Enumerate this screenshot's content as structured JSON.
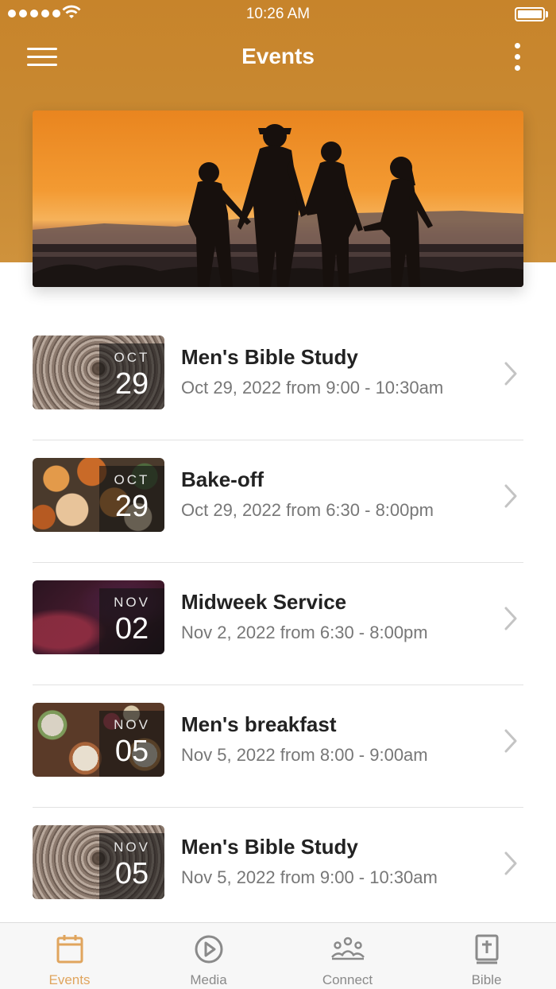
{
  "status_bar": {
    "time": "10:26 AM"
  },
  "nav": {
    "title": "Events",
    "menu_icon": "hamburger-menu-icon",
    "more_icon": "more-vertical-icon"
  },
  "hero": {
    "description_icon": "family-sunset-photo"
  },
  "events": [
    {
      "month": "OCT",
      "day": "29",
      "title": "Men's Bible Study",
      "when": "Oct 29, 2022 from 9:00 - 10:30am",
      "thumb": "wood"
    },
    {
      "month": "OCT",
      "day": "29",
      "title": "Bake-off",
      "when": "Oct 29, 2022 from 6:30 - 8:00pm",
      "thumb": "pumpkin"
    },
    {
      "month": "NOV",
      "day": "02",
      "title": "Midweek Service",
      "when": "Nov 2, 2022 from 6:30 - 8:00pm",
      "thumb": "purple"
    },
    {
      "month": "NOV",
      "day": "05",
      "title": "Men's breakfast",
      "when": "Nov 5, 2022 from 8:00 - 9:00am",
      "thumb": "breakfast"
    },
    {
      "month": "NOV",
      "day": "05",
      "title": "Men's Bible Study",
      "when": "Nov 5, 2022 from 9:00 - 10:30am",
      "thumb": "wood"
    }
  ],
  "tabs": [
    {
      "label": "Events",
      "icon": "calendar-icon",
      "active": true
    },
    {
      "label": "Media",
      "icon": "play-circle-icon",
      "active": false
    },
    {
      "label": "Connect",
      "icon": "group-icon",
      "active": false
    },
    {
      "label": "Bible",
      "icon": "bible-icon",
      "active": false
    }
  ],
  "colors": {
    "accent": "#e0a55e",
    "header": "#c98a33",
    "tab_inactive": "#8a8a8a"
  }
}
